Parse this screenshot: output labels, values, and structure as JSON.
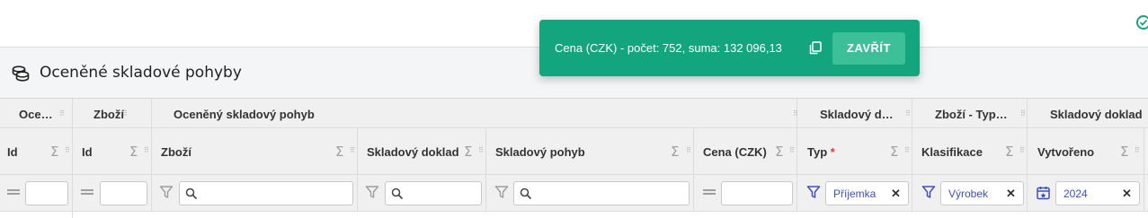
{
  "title": "Oceněné skladové pohyby",
  "toast": {
    "message": "Cena (CZK) - počet: 752, suma: 132 096,13",
    "close_label": "ZAVŘÍT"
  },
  "grid": {
    "groups": [
      "Oce…",
      "Zboží",
      "Oceněný skladový pohyb",
      "Skladový d…",
      "Zboží - Typ…",
      "Skladový doklad"
    ],
    "columns": {
      "c1": "Id",
      "c2": "Id",
      "c3": "Zboží",
      "c4": "Skladový doklad",
      "c5": "Skladový pohyb",
      "c6": "Cena (CZK)",
      "c7": "Typ",
      "c7_required": "*",
      "c8": "Klasifikace",
      "c9": "Vytvořeno"
    },
    "filters": {
      "typ": "Příjemka",
      "klasifikace": "Výrobek",
      "vytvoreno": "2024"
    },
    "sum_symbol": "Σ"
  },
  "colors": {
    "toast_bg": "#13a67e",
    "accent": "#3f51b5",
    "header_bg": "#f0f0f0"
  }
}
